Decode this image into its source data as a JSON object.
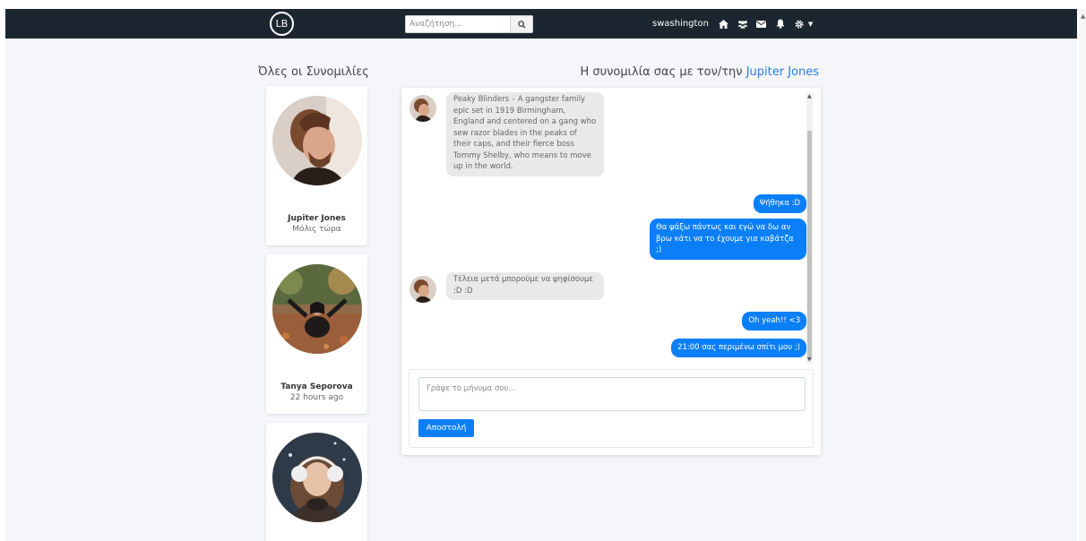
{
  "navbar": {
    "logo_text": "LB",
    "search_placeholder": "Αναζήτηση...",
    "username": "swashington",
    "icons": [
      "search-icon",
      "home-icon",
      "users-icon",
      "mail-icon",
      "bell-icon",
      "gear-icon"
    ]
  },
  "sidebar": {
    "title": "Όλες οι Συνομιλίες",
    "contacts": [
      {
        "name": "Jupiter Jones",
        "time": "Μόλις τώρα"
      },
      {
        "name": "Tanya Seporova",
        "time": "22 hours ago"
      },
      {
        "name": "",
        "time": ""
      }
    ]
  },
  "chat": {
    "title_prefix": "Η συνομιλία σας με τον/την ",
    "partner_name": "Jupiter Jones",
    "messages": [
      {
        "direction": "in",
        "text": "Peaky Blinders – A gangster family epic set in 1919 Birmingham, England and centered on a gang who sew razor blades in the peaks of their caps, and their fierce boss Tommy Shelby, who means to move up in the world."
      },
      {
        "direction": "out",
        "text": "Ψήθηκα :D"
      },
      {
        "direction": "out",
        "text": "Θα ψάξω πάντως και εγώ να δω αν βρω κάτι να το έχουμε για καβάτζα ;)"
      },
      {
        "direction": "in",
        "text": "Τέλεια μετά μπορούμε να ψηφίσουμε :D :D"
      },
      {
        "direction": "out",
        "text": "Oh yeah!! <3"
      },
      {
        "direction": "out",
        "text": "21:00 σας περιμένω σπίτι μου ;)"
      }
    ],
    "compose_placeholder": "Γράψε το μήνυμα σου...",
    "send_label": "Αποστολή"
  },
  "colors": {
    "navbar_bg": "#1c2630",
    "accent": "#0b7ff8",
    "link": "#2c7be5",
    "page_bg": "#f4f6f9"
  }
}
